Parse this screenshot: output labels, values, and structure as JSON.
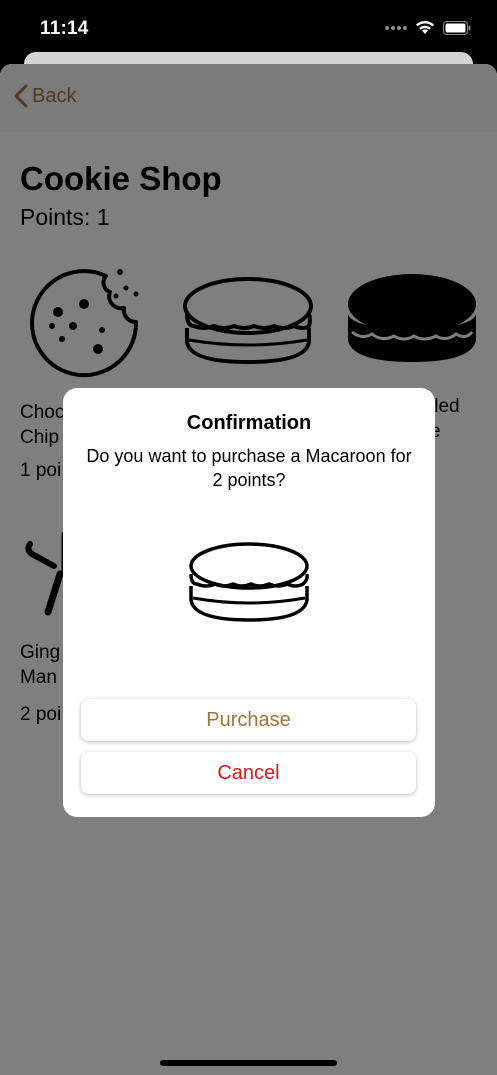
{
  "status_bar": {
    "time": "11:14",
    "icons": [
      "signal-dots-icon",
      "wifi-icon",
      "battery-icon"
    ]
  },
  "nav": {
    "back_label": "Back",
    "accent_color": "#a0723d"
  },
  "page": {
    "title": "Cookie Shop",
    "points": "Points: 1"
  },
  "cookies": [
    {
      "name_line1": "Choc",
      "name_line2": "Chip",
      "price": "1 poi",
      "icon": "chocolate-chip-cookie-icon"
    },
    {
      "icon": "macaroon-icon"
    },
    {
      "name_line1": "lled",
      "name_line2": "e",
      "icon": "filled-cookie-icon"
    },
    {
      "name_line1": "Ging",
      "name_line2": "Man",
      "price": "2 poi",
      "icon": "gingerbread-man-icon"
    }
  ],
  "dialog": {
    "title": "Confirmation",
    "message": "Do you want to purchase a Macaroon for 2 points?",
    "image": "macaroon-icon",
    "purchase_label": "Purchase",
    "cancel_label": "Cancel",
    "cancel_color": "#e0141c"
  }
}
